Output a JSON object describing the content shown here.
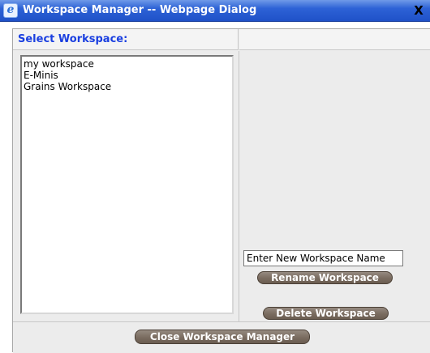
{
  "window": {
    "title": "Workspace Manager -- Webpage Dialog",
    "close_glyph": "X",
    "browser_icon_glyph": "e"
  },
  "header": {
    "select_label": "Select Workspace:"
  },
  "workspaces": {
    "items": [
      "my workspace",
      "E-Minis",
      "Grains Workspace"
    ]
  },
  "rename": {
    "input_value": "Enter New Workspace Name",
    "button_label": "Rename Workspace"
  },
  "delete": {
    "button_label": "Delete Workspace"
  },
  "footer": {
    "close_label": "Close Workspace Manager"
  },
  "colors": {
    "title_bar": "#2d62d6",
    "header_text": "#1a3fe0",
    "button": "#7a6c60"
  }
}
